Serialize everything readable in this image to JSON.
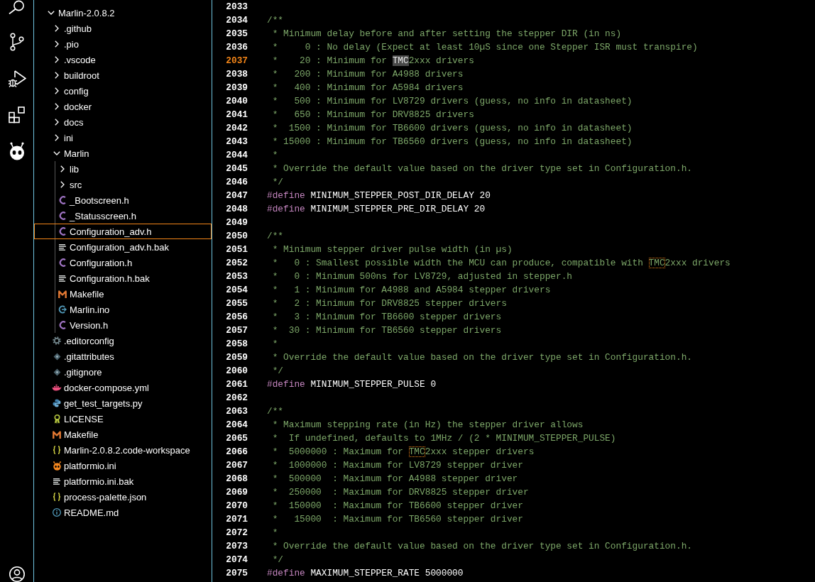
{
  "explorer": {
    "tree": [
      {
        "name": "Marlin-2.0.8.2",
        "kind": "folder",
        "expanded": true,
        "selected": false,
        "children": [
          {
            "name": ".github",
            "kind": "folder",
            "expanded": false,
            "selected": false
          },
          {
            "name": ".pio",
            "kind": "folder",
            "expanded": false,
            "selected": false
          },
          {
            "name": ".vscode",
            "kind": "folder",
            "expanded": false,
            "selected": false
          },
          {
            "name": "buildroot",
            "kind": "folder",
            "expanded": false,
            "selected": false
          },
          {
            "name": "config",
            "kind": "folder",
            "expanded": false,
            "selected": false
          },
          {
            "name": "docker",
            "kind": "folder",
            "expanded": false,
            "selected": false
          },
          {
            "name": "docs",
            "kind": "folder",
            "expanded": false,
            "selected": false
          },
          {
            "name": "ini",
            "kind": "folder",
            "expanded": false,
            "selected": false
          },
          {
            "name": "Marlin",
            "kind": "folder",
            "expanded": true,
            "selected": false,
            "children": [
              {
                "name": "lib",
                "kind": "folder",
                "expanded": false,
                "selected": false
              },
              {
                "name": "src",
                "kind": "folder",
                "expanded": false,
                "selected": false
              },
              {
                "name": "_Bootscreen.h",
                "kind": "header",
                "selected": false
              },
              {
                "name": "_Statusscreen.h",
                "kind": "header",
                "selected": false
              },
              {
                "name": "Configuration_adv.h",
                "kind": "header",
                "selected": true
              },
              {
                "name": "Configuration_adv.h.bak",
                "kind": "text",
                "selected": false
              },
              {
                "name": "Configuration.h",
                "kind": "header",
                "selected": false
              },
              {
                "name": "Configuration.h.bak",
                "kind": "text",
                "selected": false
              },
              {
                "name": "Makefile",
                "kind": "makefile",
                "selected": false
              },
              {
                "name": "Marlin.ino",
                "kind": "sketch",
                "selected": false
              },
              {
                "name": "Version.h",
                "kind": "header",
                "selected": false
              }
            ]
          },
          {
            "name": ".editorconfig",
            "kind": "settings",
            "selected": false
          },
          {
            "name": ".gitattributes",
            "kind": "git",
            "selected": false
          },
          {
            "name": ".gitignore",
            "kind": "git",
            "selected": false
          },
          {
            "name": "docker-compose.yml",
            "kind": "docker",
            "selected": false
          },
          {
            "name": "get_test_targets.py",
            "kind": "python",
            "selected": false
          },
          {
            "name": "LICENSE",
            "kind": "license",
            "selected": false
          },
          {
            "name": "Makefile",
            "kind": "makefile",
            "selected": false
          },
          {
            "name": "Marlin-2.0.8.2.code-workspace",
            "kind": "json",
            "selected": false
          },
          {
            "name": "platformio.ini",
            "kind": "platformio",
            "selected": false
          },
          {
            "name": "platformio.ini.bak",
            "kind": "text",
            "selected": false
          },
          {
            "name": "process-palette.json",
            "kind": "json",
            "selected": false
          },
          {
            "name": "README.md",
            "kind": "readme",
            "selected": false
          }
        ]
      }
    ]
  },
  "editor": {
    "lines": [
      {
        "number": "2033",
        "current": false
      },
      {
        "number": "2034",
        "current": false,
        "tokens": [
          {
            "kind": "comment",
            "text": "/**"
          }
        ]
      },
      {
        "number": "2035",
        "current": false,
        "tokens": [
          {
            "kind": "comment",
            "text": " * Minimum delay before and after setting the stepper DIR (in ns)"
          }
        ]
      },
      {
        "number": "2036",
        "current": false,
        "tokens": [
          {
            "kind": "comment",
            "text": " *     0 : No delay (Expect at least 10µS since one Stepper ISR must transpire)"
          }
        ]
      },
      {
        "number": "2037",
        "current": true,
        "tokens": [
          {
            "kind": "comment",
            "text": " *    20 : Minimum for "
          },
          {
            "kind": "comment",
            "text": "TMC",
            "selected": true,
            "match": false
          },
          {
            "kind": "comment",
            "text": "2xxx drivers"
          }
        ]
      },
      {
        "number": "2038",
        "current": false,
        "tokens": [
          {
            "kind": "comment",
            "text": " *   200 : Minimum for A4988 drivers"
          }
        ]
      },
      {
        "number": "2039",
        "current": false,
        "tokens": [
          {
            "kind": "comment",
            "text": " *   400 : Minimum for A5984 drivers"
          }
        ]
      },
      {
        "number": "2040",
        "current": false,
        "tokens": [
          {
            "kind": "comment",
            "text": " *   500 : Minimum for LV8729 drivers (guess, no info in datasheet)"
          }
        ]
      },
      {
        "number": "2041",
        "current": false,
        "tokens": [
          {
            "kind": "comment",
            "text": " *   650 : Minimum for DRV8825 drivers"
          }
        ]
      },
      {
        "number": "2042",
        "current": false,
        "tokens": [
          {
            "kind": "comment",
            "text": " *  1500 : Minimum for TB6600 drivers (guess, no info in datasheet)"
          }
        ]
      },
      {
        "number": "2043",
        "current": false,
        "tokens": [
          {
            "kind": "comment",
            "text": " * 15000 : Minimum for TB6560 drivers (guess, no info in datasheet)"
          }
        ]
      },
      {
        "number": "2044",
        "current": false,
        "tokens": [
          {
            "kind": "comment",
            "text": " *"
          }
        ]
      },
      {
        "number": "2045",
        "current": false,
        "tokens": [
          {
            "kind": "comment",
            "text": " * Override the default value based on the driver type set in Configuration.h."
          }
        ]
      },
      {
        "number": "2046",
        "current": false,
        "tokens": [
          {
            "kind": "comment",
            "text": " */"
          }
        ]
      },
      {
        "number": "2047",
        "current": false,
        "tokens": [
          {
            "kind": "directive",
            "text": "#define"
          },
          {
            "kind": "plain",
            "text": " MINIMUM_STEPPER_POST_DIR_DELAY 20"
          }
        ]
      },
      {
        "number": "2048",
        "current": false,
        "tokens": [
          {
            "kind": "directive",
            "text": "#define"
          },
          {
            "kind": "plain",
            "text": " MINIMUM_STEPPER_PRE_DIR_DELAY 20"
          }
        ]
      },
      {
        "number": "2049",
        "current": false
      },
      {
        "number": "2050",
        "current": false,
        "tokens": [
          {
            "kind": "comment",
            "text": "/**"
          }
        ]
      },
      {
        "number": "2051",
        "current": false,
        "tokens": [
          {
            "kind": "comment",
            "text": " * Minimum stepper driver pulse width (in µs)"
          }
        ]
      },
      {
        "number": "2052",
        "current": false,
        "tokens": [
          {
            "kind": "comment",
            "text": " *   0 : Smallest possible width the MCU can produce, compatible with "
          },
          {
            "kind": "comment",
            "text": "TMC",
            "selected": false,
            "match": true
          },
          {
            "kind": "comment",
            "text": "2xxx drivers"
          }
        ]
      },
      {
        "number": "2053",
        "current": false,
        "tokens": [
          {
            "kind": "comment",
            "text": " *   0 : Minimum 500ns for LV8729, adjusted in stepper.h"
          }
        ]
      },
      {
        "number": "2054",
        "current": false,
        "tokens": [
          {
            "kind": "comment",
            "text": " *   1 : Minimum for A4988 and A5984 stepper drivers"
          }
        ]
      },
      {
        "number": "2055",
        "current": false,
        "tokens": [
          {
            "kind": "comment",
            "text": " *   2 : Minimum for DRV8825 stepper drivers"
          }
        ]
      },
      {
        "number": "2056",
        "current": false,
        "tokens": [
          {
            "kind": "comment",
            "text": " *   3 : Minimum for TB6600 stepper drivers"
          }
        ]
      },
      {
        "number": "2057",
        "current": false,
        "tokens": [
          {
            "kind": "comment",
            "text": " *  30 : Minimum for TB6560 stepper drivers"
          }
        ]
      },
      {
        "number": "2058",
        "current": false,
        "tokens": [
          {
            "kind": "comment",
            "text": " *"
          }
        ]
      },
      {
        "number": "2059",
        "current": false,
        "tokens": [
          {
            "kind": "comment",
            "text": " * Override the default value based on the driver type set in Configuration.h."
          }
        ]
      },
      {
        "number": "2060",
        "current": false,
        "tokens": [
          {
            "kind": "comment",
            "text": " */"
          }
        ]
      },
      {
        "number": "2061",
        "current": false,
        "tokens": [
          {
            "kind": "directive",
            "text": "#define"
          },
          {
            "kind": "plain",
            "text": " MINIMUM_STEPPER_PULSE 0"
          }
        ]
      },
      {
        "number": "2062",
        "current": false
      },
      {
        "number": "2063",
        "current": false,
        "tokens": [
          {
            "kind": "comment",
            "text": "/**"
          }
        ]
      },
      {
        "number": "2064",
        "current": false,
        "tokens": [
          {
            "kind": "comment",
            "text": " * Maximum stepping rate (in Hz) the stepper driver allows"
          }
        ]
      },
      {
        "number": "2065",
        "current": false,
        "tokens": [
          {
            "kind": "comment",
            "text": " *  If undefined, defaults to 1MHz / (2 * MINIMUM_STEPPER_PULSE)"
          }
        ]
      },
      {
        "number": "2066",
        "current": false,
        "tokens": [
          {
            "kind": "comment",
            "text": " *  5000000 : Maximum for "
          },
          {
            "kind": "comment",
            "text": "TMC",
            "selected": false,
            "match": true
          },
          {
            "kind": "comment",
            "text": "2xxx stepper drivers"
          }
        ]
      },
      {
        "number": "2067",
        "current": false,
        "tokens": [
          {
            "kind": "comment",
            "text": " *  1000000 : Maximum for LV8729 stepper driver"
          }
        ]
      },
      {
        "number": "2068",
        "current": false,
        "tokens": [
          {
            "kind": "comment",
            "text": " *  500000  : Maximum for A4988 stepper driver"
          }
        ]
      },
      {
        "number": "2069",
        "current": false,
        "tokens": [
          {
            "kind": "comment",
            "text": " *  250000  : Maximum for DRV8825 stepper driver"
          }
        ]
      },
      {
        "number": "2070",
        "current": false,
        "tokens": [
          {
            "kind": "comment",
            "text": " *  150000  : Maximum for TB6600 stepper driver"
          }
        ]
      },
      {
        "number": "2071",
        "current": false,
        "tokens": [
          {
            "kind": "comment",
            "text": " *   15000  : Maximum for TB6560 stepper driver"
          }
        ]
      },
      {
        "number": "2072",
        "current": false,
        "tokens": [
          {
            "kind": "comment",
            "text": " *"
          }
        ]
      },
      {
        "number": "2073",
        "current": false,
        "tokens": [
          {
            "kind": "comment",
            "text": " * Override the default value based on the driver type set in Configuration.h."
          }
        ]
      },
      {
        "number": "2074",
        "current": false,
        "tokens": [
          {
            "kind": "comment",
            "text": " */"
          }
        ]
      },
      {
        "number": "2075",
        "current": false,
        "tokens": [
          {
            "kind": "directive",
            "text": "#define"
          },
          {
            "kind": "plain",
            "text": " MAXIMUM_STEPPER_RATE 5000000"
          }
        ]
      }
    ]
  }
}
